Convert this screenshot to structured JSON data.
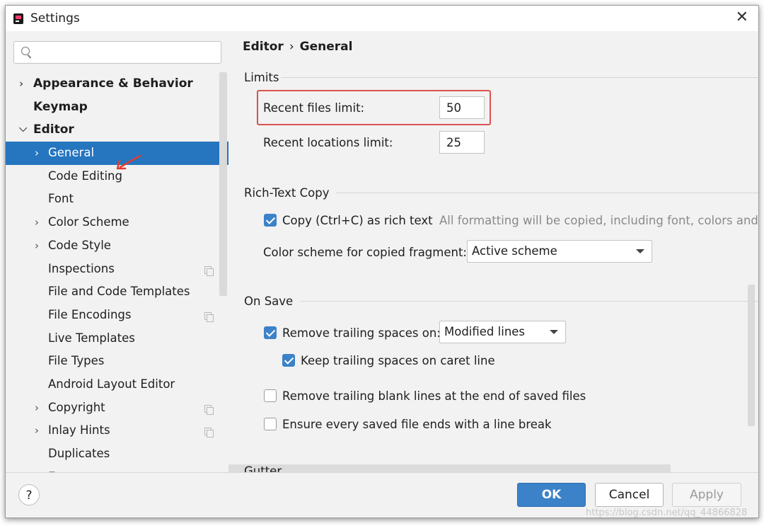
{
  "window": {
    "title": "Settings"
  },
  "sidebar": {
    "search": {
      "placeholder": ""
    },
    "items": [
      {
        "label": "Appearance & Behavior",
        "bold": true,
        "chevron": "right",
        "level": 0
      },
      {
        "label": "Keymap",
        "bold": true,
        "chevron": "",
        "level": 0
      },
      {
        "label": "Editor",
        "bold": true,
        "chevron": "down",
        "level": 0
      },
      {
        "label": "General",
        "chevron": "right",
        "level": 1,
        "selected": true
      },
      {
        "label": "Code Editing",
        "chevron": "",
        "level": 1
      },
      {
        "label": "Font",
        "chevron": "",
        "level": 1
      },
      {
        "label": "Color Scheme",
        "chevron": "right",
        "level": 1
      },
      {
        "label": "Code Style",
        "chevron": "right",
        "level": 1
      },
      {
        "label": "Inspections",
        "chevron": "",
        "level": 1,
        "project_icon": true
      },
      {
        "label": "File and Code Templates",
        "chevron": "",
        "level": 1
      },
      {
        "label": "File Encodings",
        "chevron": "",
        "level": 1,
        "project_icon": true
      },
      {
        "label": "Live Templates",
        "chevron": "",
        "level": 1
      },
      {
        "label": "File Types",
        "chevron": "",
        "level": 1
      },
      {
        "label": "Android Layout Editor",
        "chevron": "",
        "level": 1
      },
      {
        "label": "Copyright",
        "chevron": "right",
        "level": 1,
        "project_icon": true
      },
      {
        "label": "Inlay Hints",
        "chevron": "right",
        "level": 1,
        "project_icon": true
      },
      {
        "label": "Duplicates",
        "chevron": "",
        "level": 1
      },
      {
        "label": "Emmet",
        "chevron": "right",
        "level": 1
      }
    ]
  },
  "content": {
    "breadcrumb": {
      "parent": "Editor",
      "separator": "›",
      "current": "General"
    },
    "limits": {
      "title": "Limits",
      "recent_files_label": "Recent files limit:",
      "recent_files_value": "50",
      "recent_locations_label": "Recent locations limit:",
      "recent_locations_value": "25"
    },
    "rich_text": {
      "title": "Rich-Text Copy",
      "copy_label": "Copy (Ctrl+C) as rich text",
      "copy_checked": true,
      "copy_hint": "All formatting will be copied, including font, colors and s",
      "scheme_label": "Color scheme for copied fragment:",
      "scheme_value": "Active scheme"
    },
    "on_save": {
      "title": "On Save",
      "remove_trailing_label": "Remove trailing spaces on:",
      "remove_trailing_checked": true,
      "remove_trailing_value": "Modified lines",
      "keep_trailing_label": "Keep trailing spaces on caret line",
      "keep_trailing_checked": true,
      "remove_blank_label": "Remove trailing blank lines at the end of saved files",
      "remove_blank_checked": false,
      "ensure_linebreak_label": "Ensure every saved file ends with a line break",
      "ensure_linebreak_checked": false
    },
    "gutter": {
      "title": "Gutter"
    }
  },
  "buttons": {
    "help": "?",
    "ok": "OK",
    "cancel": "Cancel",
    "apply": "Apply"
  },
  "watermark": "https://blog.csdn.net/qq_44866828",
  "colors": {
    "selection": "#2675bf",
    "primary_button": "#3b82c9",
    "highlight_border": "#d9534f",
    "annotation_arrow": "#e03c31"
  }
}
